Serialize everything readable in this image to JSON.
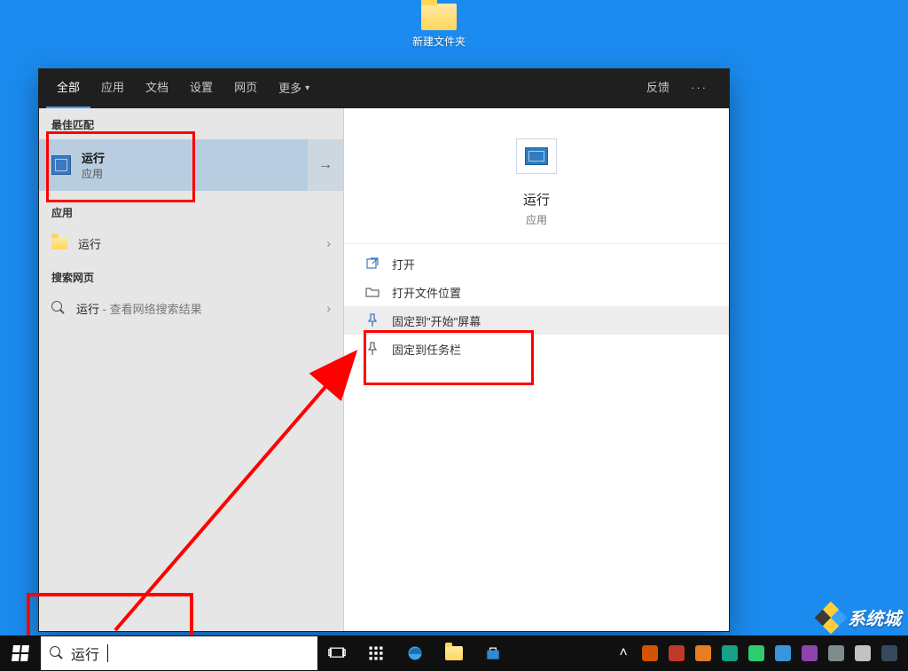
{
  "desktop": {
    "folder_label": "新建文件夹"
  },
  "header": {
    "tabs": {
      "all": "全部",
      "apps": "应用",
      "docs": "文档",
      "settings": "设置",
      "web": "网页",
      "more": "更多"
    },
    "feedback": "反馈"
  },
  "sections": {
    "best": "最佳匹配",
    "apps": "应用",
    "web": "搜索网页"
  },
  "best": {
    "title": "运行",
    "subtitle": "应用"
  },
  "apps_row": {
    "label": "运行"
  },
  "web_row": {
    "query": "运行",
    "suffix": " - 查看网络搜索结果"
  },
  "detail": {
    "title": "运行",
    "subtitle": "应用"
  },
  "actions": {
    "open": "打开",
    "open_location": "打开文件位置",
    "pin_start": "固定到\"开始\"屏幕",
    "pin_taskbar": "固定到任务栏"
  },
  "search": {
    "query": "运行"
  },
  "watermark": "系统城"
}
